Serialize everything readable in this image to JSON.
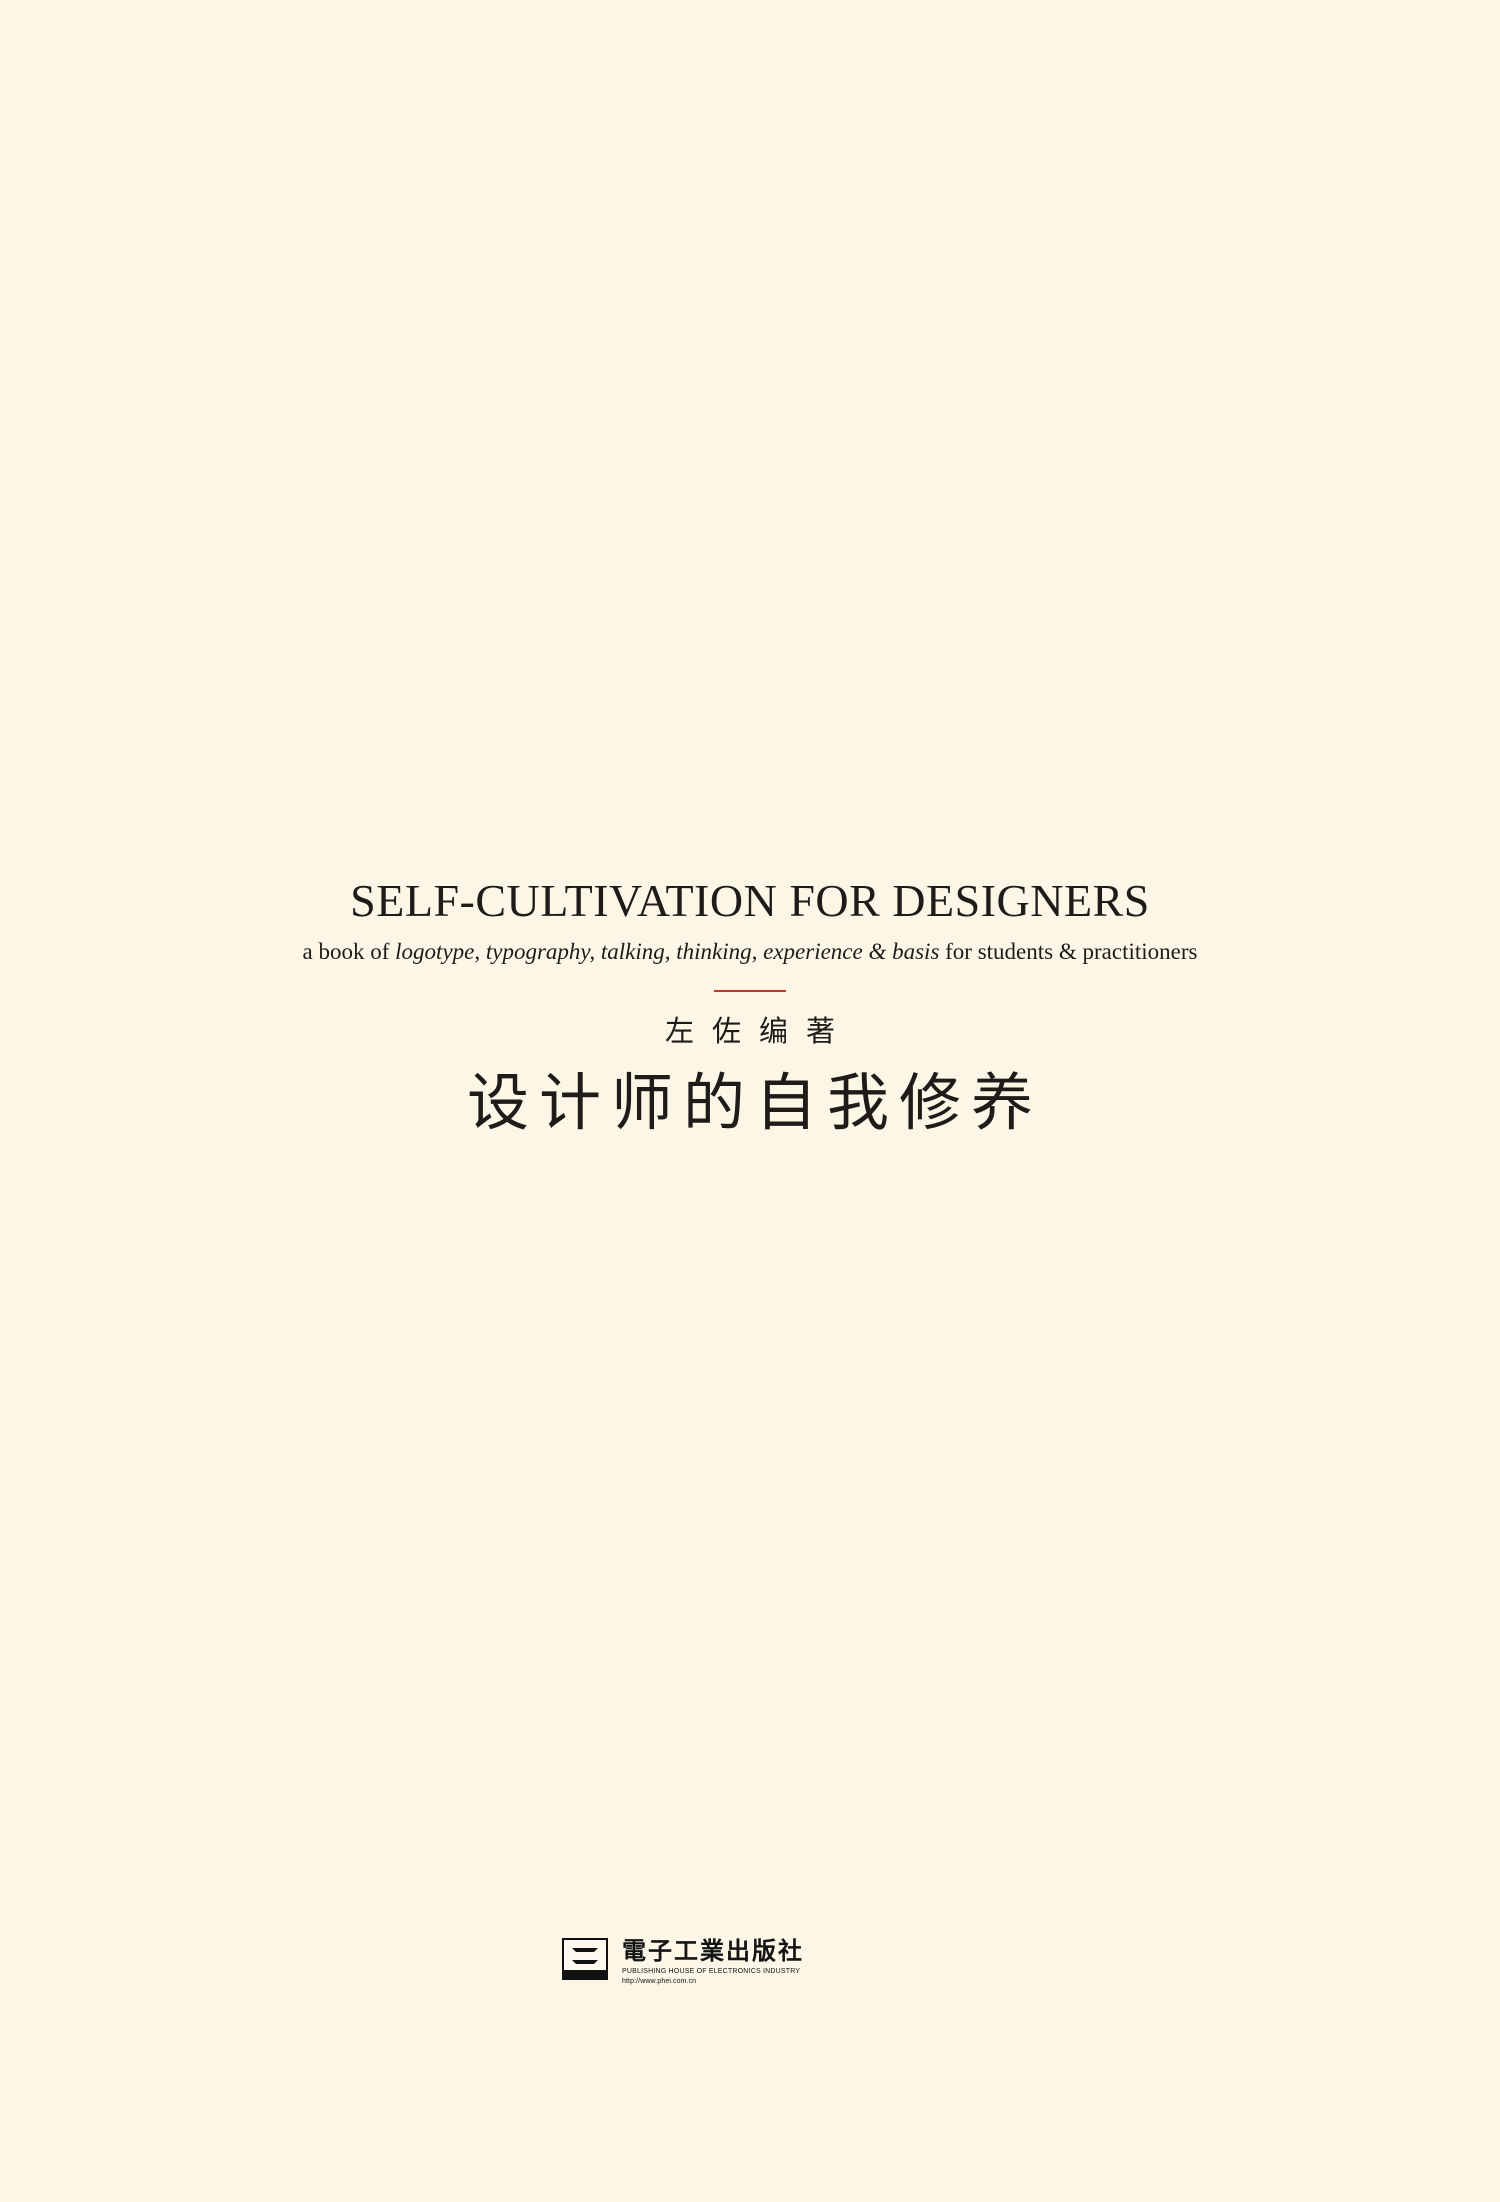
{
  "book": {
    "title_en": "SELF-CULTIVATION FOR DESIGNERS",
    "subtitle_parts": {
      "prefix": "a book of ",
      "italic_terms": "logotype, typography, talking, thinking, experience & basis",
      "suffix": " for students & practitioners"
    },
    "author_cn": "左佐编著",
    "title_cn": "设计师的自我修养"
  },
  "publisher": {
    "name_cn": "電子工業出版社",
    "name_en": "PUBLISHING HOUSE OF ELECTRONICS INDUSTRY",
    "url": "http://www.phei.com.cn"
  },
  "colors": {
    "background": "#fcf6e6",
    "divider": "#c9352d",
    "text": "#1f1b18"
  }
}
